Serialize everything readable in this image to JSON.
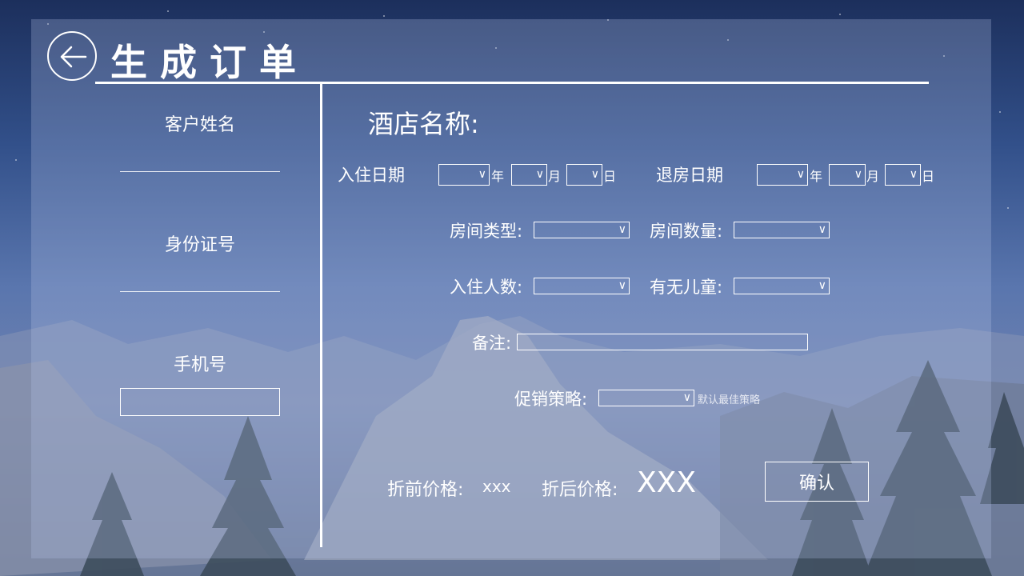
{
  "header": {
    "title": "生成订单",
    "back_icon": "arrow-left-circle-icon"
  },
  "customer": {
    "name_label": "客户姓名",
    "id_label": "身份证号",
    "phone_label": "手机号",
    "phone_value": ""
  },
  "hotel": {
    "name_label": "酒店名称:"
  },
  "dates": {
    "checkin_label": "入住日期",
    "checkout_label": "退房日期",
    "year_unit": "年",
    "month_unit": "月",
    "day_unit": "日"
  },
  "room": {
    "type_label": "房间类型:",
    "count_label": "房间数量:",
    "guests_label": "入住人数:",
    "children_label": "有无儿童:",
    "remark_label": "备注:",
    "promo_label": "促销策略:",
    "promo_note": "默认最佳策略"
  },
  "price": {
    "original_label": "折前价格:",
    "original_value": "xxx",
    "discount_label": "折后价格:",
    "discount_value": "XXX"
  },
  "actions": {
    "confirm_label": "确认"
  },
  "colors": {
    "text": "#ffffff",
    "panel": "rgba(180,195,230,0.28)"
  }
}
